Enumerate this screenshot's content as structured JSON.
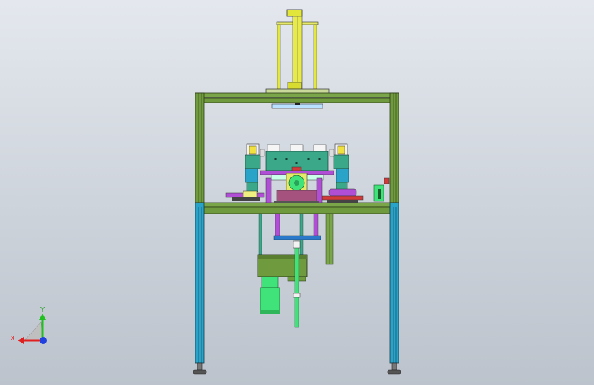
{
  "viewport": {
    "background_top": "#e4e8ee",
    "background_bottom": "#bcc3cc"
  },
  "model": {
    "frame_color": "#6f9a3e",
    "leg_color": "#2aa3c9",
    "cylinder_color": "#d8dc3c",
    "fixture_color": "#3aa889",
    "accent_purple": "#b04fd6",
    "accent_red": "#d23a3a",
    "motor_color": "#3fe37a",
    "gearbox_color": "#6f9a3e"
  },
  "triad": {
    "x_label": "X",
    "y_label": "Y",
    "x_color": "#e02020",
    "y_color": "#20c020",
    "z_color": "#2040e0"
  }
}
